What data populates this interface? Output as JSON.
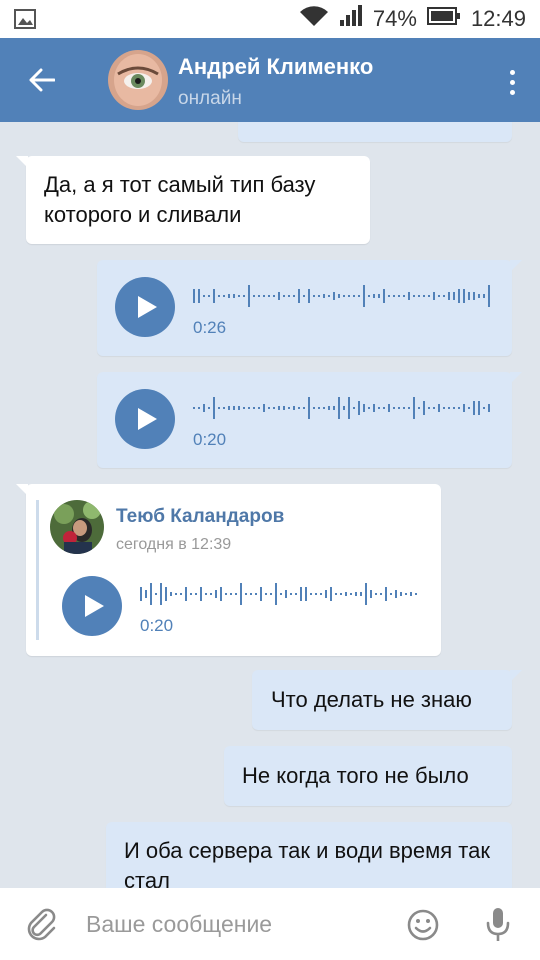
{
  "status_bar": {
    "battery_percent": "74%",
    "time": "12:49",
    "icons": [
      "image-icon",
      "wifi-icon",
      "signal-icon",
      "battery-icon"
    ]
  },
  "header": {
    "contact_name": "Андрей Клименко",
    "contact_status": "онлайн",
    "icons": [
      "back-arrow-icon",
      "avatar",
      "more-vertical-icon"
    ]
  },
  "messages": [
    {
      "type": "text",
      "direction": "in",
      "text": "Да, а я тот самый тип базу которого и сливали"
    },
    {
      "type": "voice",
      "direction": "out",
      "duration": "0:26"
    },
    {
      "type": "voice",
      "direction": "out",
      "duration": "0:20"
    },
    {
      "type": "forwarded",
      "direction": "in",
      "author": "Теюб Каландаров",
      "time": "сегодня в 12:39",
      "duration": "0:20"
    },
    {
      "type": "text",
      "direction": "out",
      "text": "Что делать не знаю"
    },
    {
      "type": "text",
      "direction": "out",
      "text": "Не когда того не было"
    },
    {
      "type": "text",
      "direction": "out",
      "text": "И оба сервера так и води время так стал"
    }
  ],
  "input": {
    "placeholder": "Ваше сообщение",
    "icons": [
      "paperclip-icon",
      "smile-icon",
      "microphone-icon"
    ]
  },
  "colors": {
    "accent": "#5181b8",
    "outgoing_bubble": "#dae7f7",
    "incoming_bubble": "#ffffff",
    "background": "#dfe5ec"
  }
}
